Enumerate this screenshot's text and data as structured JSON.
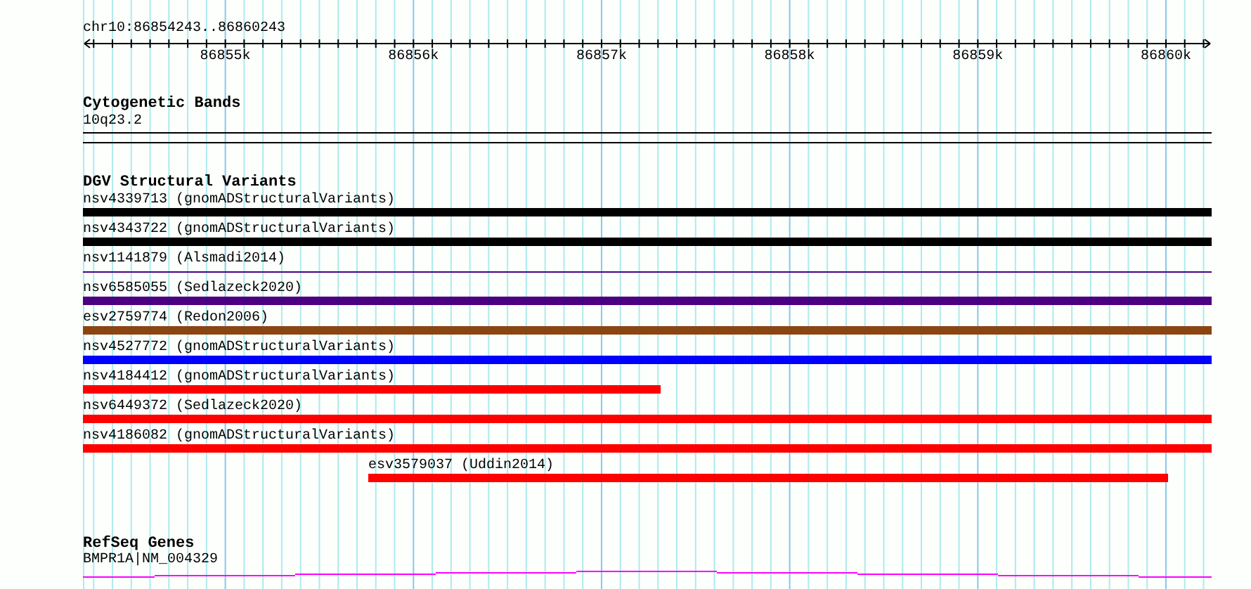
{
  "location": "chr10:86854243..86860243",
  "ruler": {
    "ticks": [
      "86855k",
      "86856k",
      "86857k",
      "86858k",
      "86859k",
      "86860k"
    ]
  },
  "tracks": [
    {
      "kind": "bands",
      "title": "Cytogenetic Bands",
      "features": [
        {
          "label": "10q23.2"
        }
      ]
    },
    {
      "kind": "variants",
      "title": "DGV Structural Variants",
      "features": [
        {
          "label": "nsv4339713 (gnomADStructuralVariants)",
          "color": "#000000",
          "kind": "bar"
        },
        {
          "label": "nsv4343722 (gnomADStructuralVariants)",
          "color": "#000000",
          "kind": "bar"
        },
        {
          "label": "nsv1141879 (Alsmadi2014)",
          "color": "#4b0082",
          "kind": "line"
        },
        {
          "label": "nsv6585055 (Sedlazeck2020)",
          "color": "#4b0082",
          "kind": "bar"
        },
        {
          "label": "esv2759774 (Redon2006)",
          "color": "#8b4513",
          "kind": "bar"
        },
        {
          "label": "nsv4527772 (gnomADStructuralVariants)",
          "color": "#0000ff",
          "kind": "bar"
        },
        {
          "label": "nsv4184412 (gnomADStructuralVariants)",
          "color": "#ff0000",
          "kind": "bar"
        },
        {
          "label": "nsv6449372 (Sedlazeck2020)",
          "color": "#ff0000",
          "kind": "bar"
        },
        {
          "label": "nsv4186082 (gnomADStructuralVariants)",
          "color": "#ff0000",
          "kind": "bar"
        },
        {
          "label": "esv3579037 (Uddin2014)",
          "color": "#ff0000",
          "kind": "bar"
        }
      ]
    },
    {
      "kind": "genes",
      "title": "RefSeq Genes",
      "features": [
        {
          "label": "BMPR1A|NM_004329",
          "color": "#ff00ff"
        }
      ]
    }
  ]
}
